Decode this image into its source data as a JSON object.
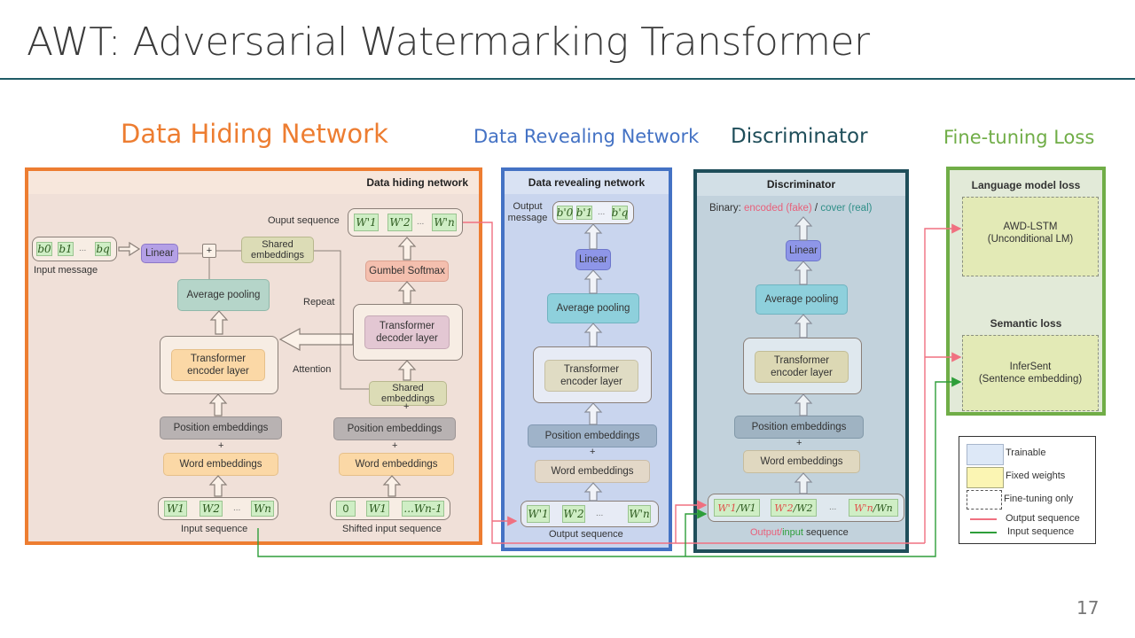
{
  "slide": {
    "title": "AWT: Adversarial Watermarking Transformer",
    "page_number": "17"
  },
  "section_labels": {
    "hiding": "Data Hiding Network",
    "revealing": "Data Revealing Network",
    "discriminator": "Discriminator",
    "finetune": "Fine-tuning Loss"
  },
  "colors": {
    "hiding": "#ed7d31",
    "revealing": "#4472c4",
    "discriminator": "#1f4e5a",
    "finetune": "#70ad47",
    "output_line": "#f07080",
    "input_line": "#2e9e3a"
  },
  "hiding": {
    "header": "Data hiding network",
    "input_message_tokens": [
      "b0",
      "b1",
      "...",
      "bq"
    ],
    "input_message_label": "Input message",
    "linear": "Linear",
    "plus": "+",
    "shared_embeddings_top": "Shared embeddings",
    "output_sequence_label": "Ouput sequence",
    "output_tokens": [
      "W'1",
      "W'2",
      "...",
      "W'n"
    ],
    "gumbel": "Gumbel Softmax",
    "average_pooling": "Average pooling",
    "repeat": "Repeat",
    "decoder_layer": "Transformer decoder layer",
    "encoder_layer": "Transformer encoder layer",
    "attention": "Attention",
    "shared_embeddings_bottom": "Shared embeddings",
    "position_embeddings": "Position embeddings",
    "word_embeddings": "Word embeddings",
    "input_tokens": [
      "W1",
      "W2",
      "...",
      "Wn"
    ],
    "input_sequence_label": "Input sequence",
    "shifted_tokens": [
      "0",
      "W1",
      "...Wn-1"
    ],
    "shifted_sequence_label": "Shifted input sequence",
    "ellipsis": "...",
    "plus_sign": "+"
  },
  "revealing": {
    "header": "Data revealing network",
    "output_message_label": "Output message",
    "output_message_tokens": [
      "b'0",
      "b'1",
      "...",
      "b'q"
    ],
    "linear": "Linear",
    "average_pooling": "Average pooling",
    "encoder_layer": "Transformer encoder layer",
    "position_embeddings": "Position embeddings",
    "word_embeddings": "Word embeddings",
    "input_tokens": [
      "W'1",
      "W'2",
      "...",
      "W'n"
    ],
    "sequence_label": "Output sequence",
    "plus_sign": "+",
    "ellipsis": "..."
  },
  "discriminator": {
    "header": "Discriminator",
    "binary_prefix": "Binary: ",
    "binary_fake": "encoded (fake)",
    "binary_sep": " / ",
    "binary_real": "cover (real)",
    "linear": "Linear",
    "average_pooling": "Average pooling",
    "encoder_layer": "Transformer encoder layer",
    "position_embeddings": "Position embeddings",
    "word_embeddings": "Word embeddings",
    "tokens": [
      {
        "out": "W'1",
        "in": "W1"
      },
      {
        "out": "W'2",
        "in": "W2"
      },
      {
        "out": "W'n",
        "in": "Wn"
      }
    ],
    "token_sep": " / ",
    "seq_output": "Output",
    "seq_slash": "/",
    "seq_input": "input",
    "seq_rest": " sequence",
    "plus_sign": "+",
    "ellipsis": "..."
  },
  "finetune": {
    "lm_header": "Language model loss",
    "lm_box": "AWD-LSTM (Unconditional LM)",
    "lm_line1": "AWD-LSTM",
    "lm_line2": "(Unconditional LM)",
    "sem_header": "Semantic loss",
    "sem_line1": "InferSent",
    "sem_line2": "(Sentence embedding)"
  },
  "legend": {
    "items": [
      {
        "label": "Trainable",
        "swatch": "#dde8f7"
      },
      {
        "label": "Fixed weights",
        "swatch": "#fbf5b3"
      },
      {
        "label": "Fine-tuning only",
        "swatch": "dashed"
      },
      {
        "label": "Output sequence",
        "swatch": "#f07080"
      },
      {
        "label": "Input sequence",
        "swatch": "#2e9e3a"
      }
    ]
  }
}
